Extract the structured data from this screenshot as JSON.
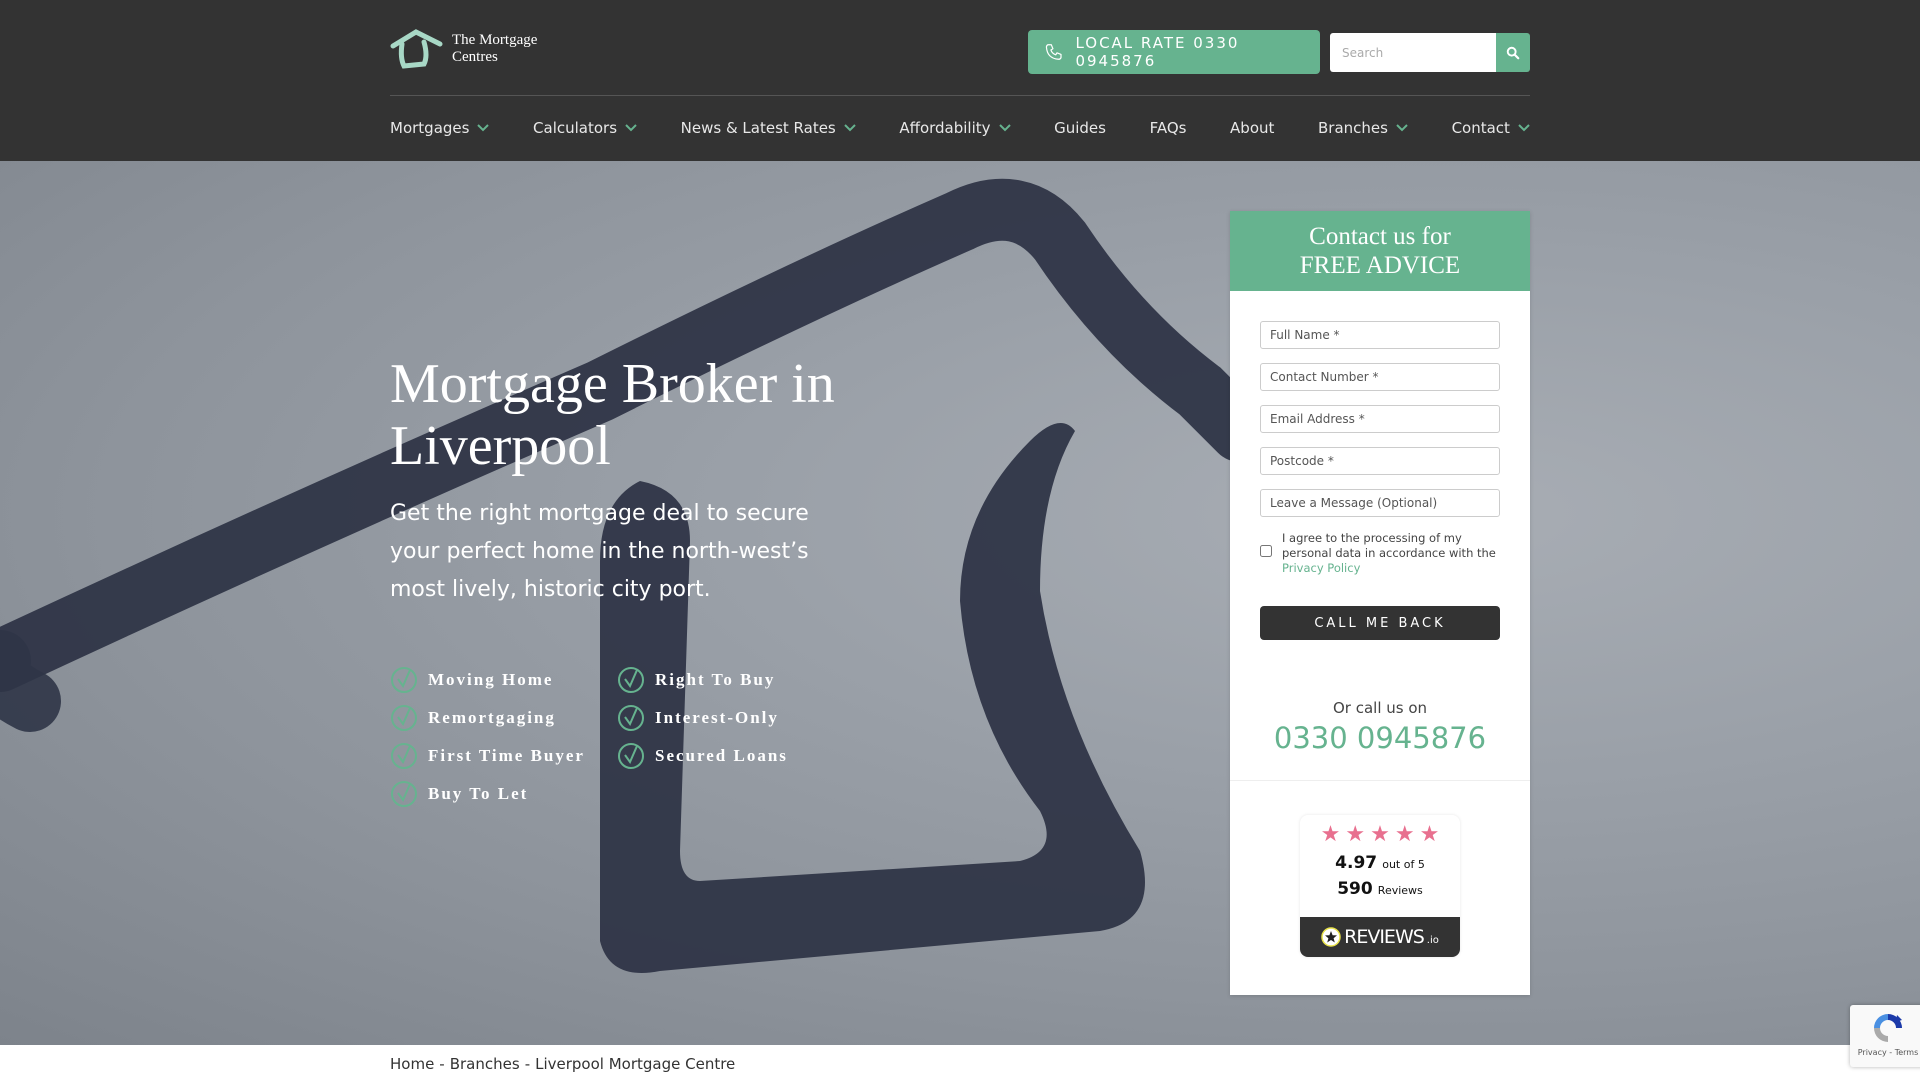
{
  "header": {
    "logo_line1": "The Mortgage",
    "logo_line2": "Centres",
    "call_button": "LOCAL RATE 0330 0945876",
    "search_placeholder": "Search"
  },
  "nav": {
    "items": [
      {
        "label": "Mortgages",
        "has_dropdown": true
      },
      {
        "label": "Calculators",
        "has_dropdown": true
      },
      {
        "label": "News & Latest Rates",
        "has_dropdown": true
      },
      {
        "label": "Affordability",
        "has_dropdown": true
      },
      {
        "label": "Guides",
        "has_dropdown": false
      },
      {
        "label": "FAQs",
        "has_dropdown": false
      },
      {
        "label": "About",
        "has_dropdown": false
      },
      {
        "label": "Branches",
        "has_dropdown": true
      },
      {
        "label": "Contact",
        "has_dropdown": true
      }
    ]
  },
  "hero": {
    "title_line1": "Mortgage Broker in",
    "title_line2": "Liverpool",
    "subtitle": "Get the right mortgage deal to secure your perfect home in the north-west’s most lively, historic city port.",
    "features": [
      "Moving Home",
      "Right To Buy",
      "Remortgaging",
      "Interest-Only",
      "First Time Buyer",
      "Secured Loans",
      "Buy To Let"
    ]
  },
  "form": {
    "heading_line1": "Contact us for",
    "heading_line2": "FREE ADVICE",
    "fields": {
      "full_name": "Full Name *",
      "contact_number": "Contact Number *",
      "email": "Email Address *",
      "postcode": "Postcode *",
      "message": "Leave a Message (Optional)"
    },
    "consent_text": "I agree to the processing of my personal data in accordance with the",
    "consent_link": "Privacy Policy",
    "consent_checked": false,
    "submit_label": "CALL ME BACK",
    "or_call": "Or call us on",
    "phone": "0330 0945876"
  },
  "reviews": {
    "stars": 5,
    "rating": "4.97",
    "rating_suffix": "out of 5",
    "count": "590",
    "count_suffix": "Reviews",
    "brand": "REVIEWS",
    "brand_suffix": ".io"
  },
  "breadcrumb": {
    "items": [
      "Home",
      "Branches",
      "Liverpool Mortgage Centre"
    ],
    "separator": "-"
  },
  "recaptcha": {
    "privacy": "Privacy",
    "separator": " - ",
    "terms": "Terms"
  },
  "colors": {
    "brand_green": "#66b38f",
    "header_dark": "#333333",
    "star_pink": "#e8708f"
  }
}
